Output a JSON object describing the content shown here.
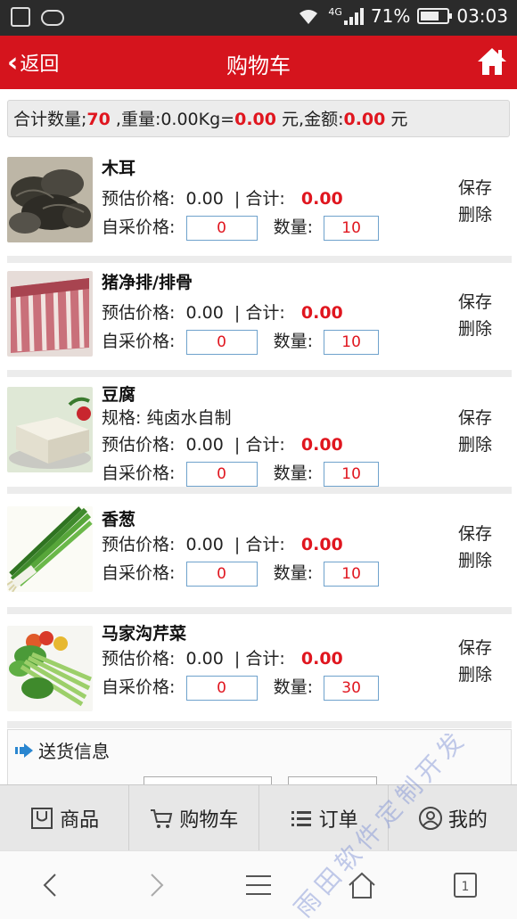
{
  "status_bar": {
    "network": "4G",
    "battery": "71%",
    "battery_level": 0.71,
    "time": "03:03"
  },
  "header": {
    "back_label": "返回",
    "title": "购物车",
    "home_icon": "home-icon"
  },
  "summary": {
    "qty_label": "合计数量;",
    "qty_value": "70",
    "weight_label": " ,重量:0.00Kg=",
    "weight_amount": "0.00",
    "yuan1": " 元,金额:",
    "total_amount": "0.00",
    "yuan2": " 元"
  },
  "labels": {
    "est_price": "预估价格:",
    "subtotal": "| 合计:",
    "self_price": "自采价格:",
    "quantity": "数量:",
    "save": "保存",
    "delete": "删除"
  },
  "items": [
    {
      "name": "木耳",
      "spec": "",
      "est_price": "0.00",
      "subtotal": "0.00",
      "self_price": "0",
      "qty": "10",
      "image": "wood-ear-mushroom"
    },
    {
      "name": "猪净排/排骨",
      "spec": "",
      "est_price": "0.00",
      "subtotal": "0.00",
      "self_price": "0",
      "qty": "10",
      "image": "pork-ribs"
    },
    {
      "name": "豆腐",
      "spec": "规格:  纯卤水自制",
      "est_price": "0.00",
      "subtotal": "0.00",
      "self_price": "0",
      "qty": "10",
      "image": "tofu"
    },
    {
      "name": "香葱",
      "spec": "",
      "est_price": "0.00",
      "subtotal": "0.00",
      "self_price": "0",
      "qty": "10",
      "image": "scallion"
    },
    {
      "name": "马家沟芹菜",
      "spec": "",
      "est_price": "0.00",
      "subtotal": "0.00",
      "self_price": "0",
      "qty": "30",
      "image": "celery"
    }
  ],
  "delivery": {
    "title": "送货信息",
    "icon": "arrow-right-icon"
  },
  "tabs": [
    {
      "label": "商品",
      "icon": "goods-icon"
    },
    {
      "label": "购物车",
      "icon": "cart-icon"
    },
    {
      "label": "订单",
      "icon": "list-icon"
    },
    {
      "label": "我的",
      "icon": "user-icon"
    }
  ],
  "nav": {
    "tab_count": "1"
  },
  "watermark": "雨田软件定制开发",
  "colors": {
    "brand_red": "#d5141d",
    "price_red": "#e0161f",
    "input_border": "#6fa2cc"
  }
}
